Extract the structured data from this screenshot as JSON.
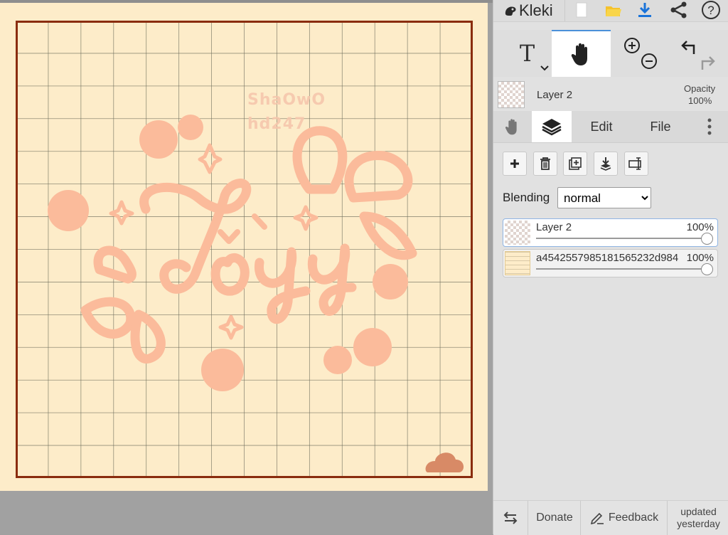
{
  "app": {
    "name": "Kleki"
  },
  "toolbar": {
    "text_tool_glyph": "T",
    "active_tool": "hand"
  },
  "layer_header": {
    "name": "Layer 2",
    "opacity_label": "Opacity",
    "opacity_value": "100%"
  },
  "tabs": {
    "edit": "Edit",
    "file": "File"
  },
  "blending": {
    "label": "Blending",
    "value": "normal",
    "options": [
      "normal"
    ]
  },
  "layers": [
    {
      "name": "Layer 2",
      "opacity": "100%",
      "opacity_fraction": 1.0,
      "selected": true
    },
    {
      "name": "a4542557985181565232d984",
      "opacity": "100%",
      "opacity_fraction": 1.0,
      "selected": false
    }
  ],
  "canvas": {
    "watermark_lines": [
      "ShaOwO",
      "hd247"
    ],
    "lettering": "Tôyy",
    "colors": {
      "paper": "#fdecc9",
      "border": "#8a2c0e",
      "grid": "#6f6f5e",
      "art": "#fbbb9b",
      "cloud": "#d88a66"
    }
  },
  "footer": {
    "donate": "Donate",
    "feedback": "Feedback",
    "updated_line1": "updated",
    "updated_line2": "yesterday"
  },
  "colors": {
    "accent": "#1a73d9",
    "active_tab_line": "#4a90d9",
    "folder": "#f5c22c"
  }
}
